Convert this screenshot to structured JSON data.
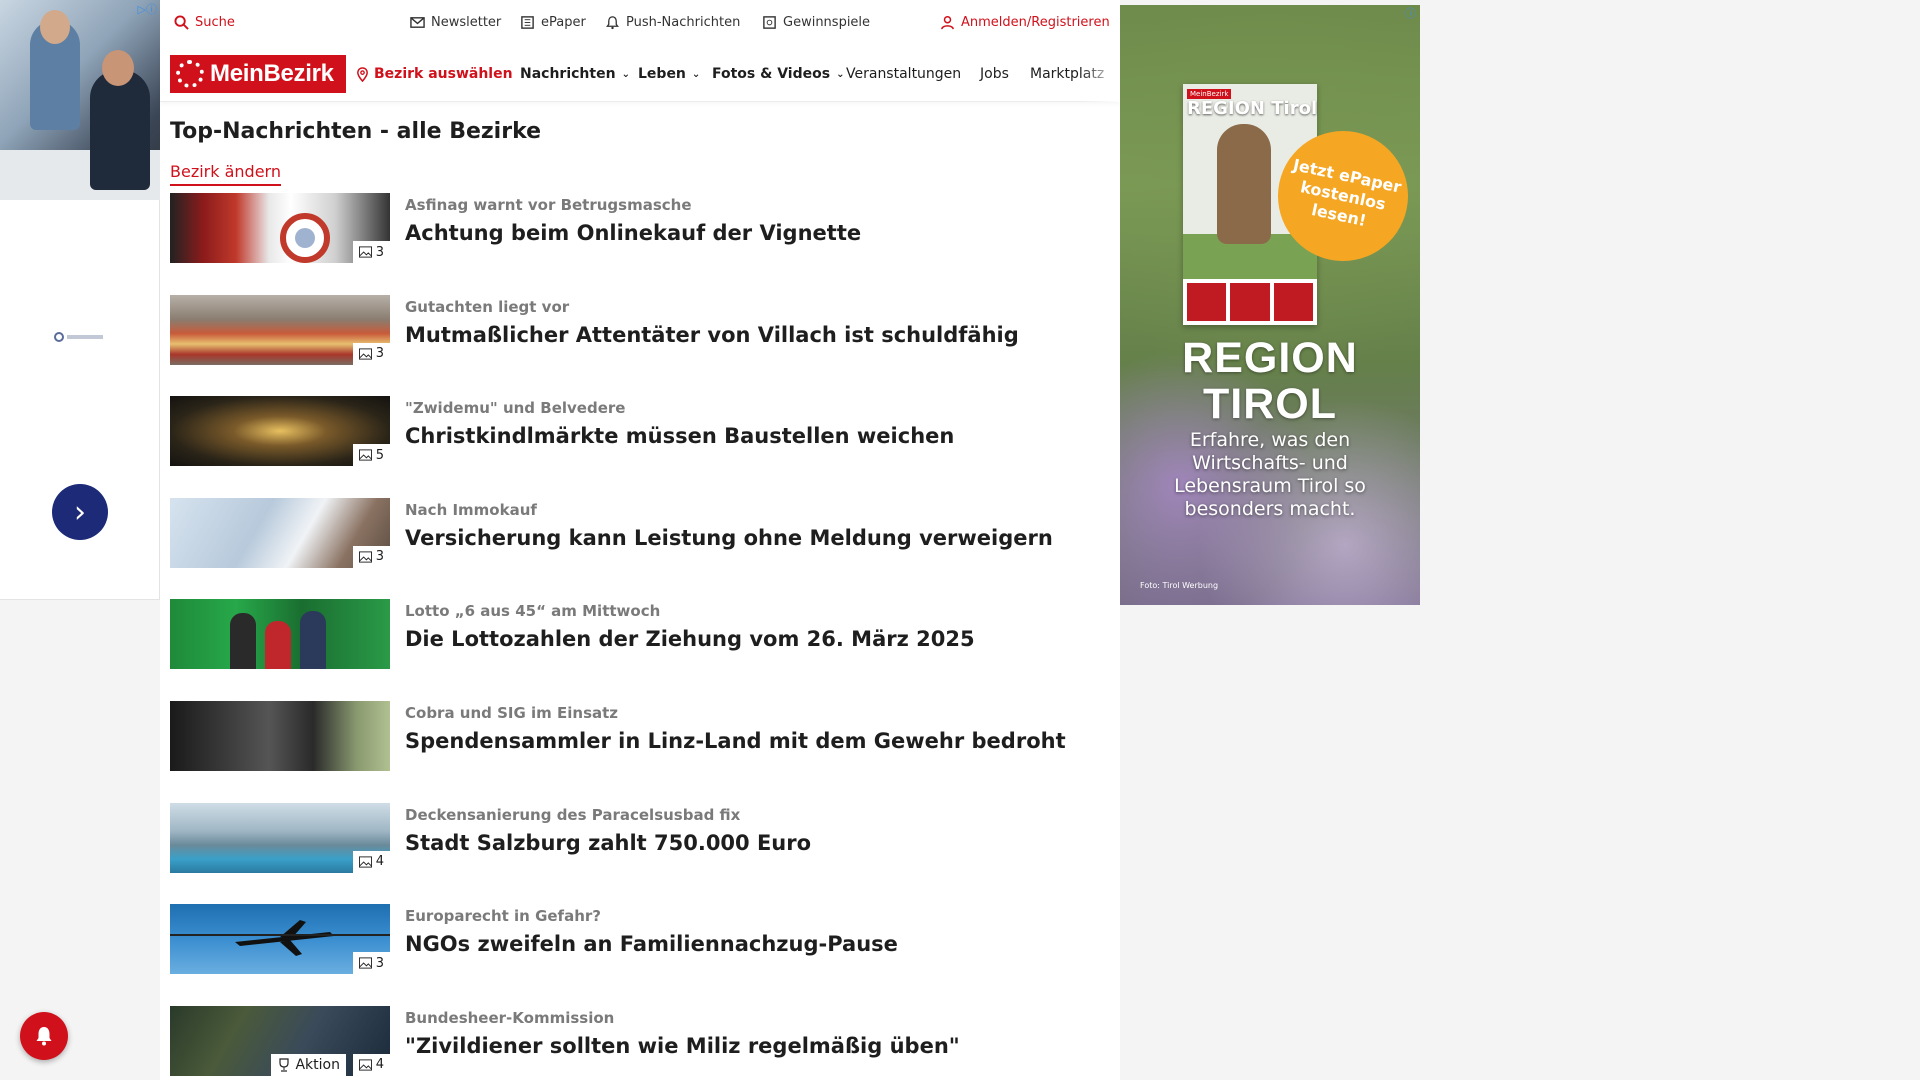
{
  "left_ad": {
    "next_label": "›"
  },
  "topbar": {
    "search": "Suche",
    "newsletter": "Newsletter",
    "epaper": "ePaper",
    "push": "Push-Nachrichten",
    "gewinnspiele": "Gewinnspiele",
    "login": "Anmelden/Registrieren"
  },
  "brand": {
    "logo_text": "MeinBezirk",
    "accent_color": "#d0111b"
  },
  "nav": {
    "bezirk": "Bezirk auswählen",
    "items": [
      {
        "label": "Nachrichten",
        "dropdown": true
      },
      {
        "label": "Leben",
        "dropdown": true
      },
      {
        "label": "Fotos & Videos",
        "dropdown": true
      },
      {
        "label": "Veranstaltungen",
        "dropdown": false
      },
      {
        "label": "Jobs",
        "dropdown": false
      },
      {
        "label": "Marktplatz",
        "dropdown": false
      }
    ]
  },
  "page": {
    "title": "Top-Nachrichten - alle Bezirke",
    "change_link": "Bezirk ändern"
  },
  "articles": [
    {
      "kicker": "Asfinag warnt vor Betrugsmasche",
      "headline": "Achtung beim Onlinekauf der Vignette",
      "photo_count": "3"
    },
    {
      "kicker": "Gutachten liegt vor",
      "headline": "Mutmaßlicher Attentäter von Villach ist schuldfähig",
      "photo_count": "3"
    },
    {
      "kicker": "\"Zwidemu\" und Belvedere",
      "headline": "Christkindlmärkte müssen Baustellen weichen",
      "photo_count": "5"
    },
    {
      "kicker": "Nach Immokauf",
      "headline": "Versicherung kann Leistung ohne Meldung verweigern",
      "photo_count": "3"
    },
    {
      "kicker": "Lotto „6 aus 45“ am Mittwoch",
      "headline": "Die Lottozahlen der Ziehung vom 26. März 2025",
      "photo_count": ""
    },
    {
      "kicker": "Cobra und SIG im Einsatz",
      "headline": "Spendensammler in Linz-Land mit dem Gewehr bedroht",
      "photo_count": ""
    },
    {
      "kicker": "Deckensanierung des Paracelsusbad fix",
      "headline": "Stadt Salzburg zahlt 750.000 Euro",
      "photo_count": "4"
    },
    {
      "kicker": "Europarecht in Gefahr?",
      "headline": "NGOs zweifeln an Familiennachzug-Pause",
      "photo_count": "3"
    },
    {
      "kicker": "Bundesheer-Kommission",
      "headline": "\"Zivildiener sollten wie Miliz regelmäßig üben\"",
      "photo_count": "4",
      "aktion": "Aktion"
    }
  ],
  "right_ad": {
    "cover_badge": "MeinBezirk",
    "cover_title": "REGION Tirol",
    "bubble": "Jetzt ePaper kostenlos lesen!",
    "big_line1": "REGION",
    "big_line2": "TIROL",
    "sub": "Erfahre, was den Wirtschafts- und Lebensraum Tirol so besonders macht.",
    "credit": "Foto: Tirol Werbung"
  }
}
